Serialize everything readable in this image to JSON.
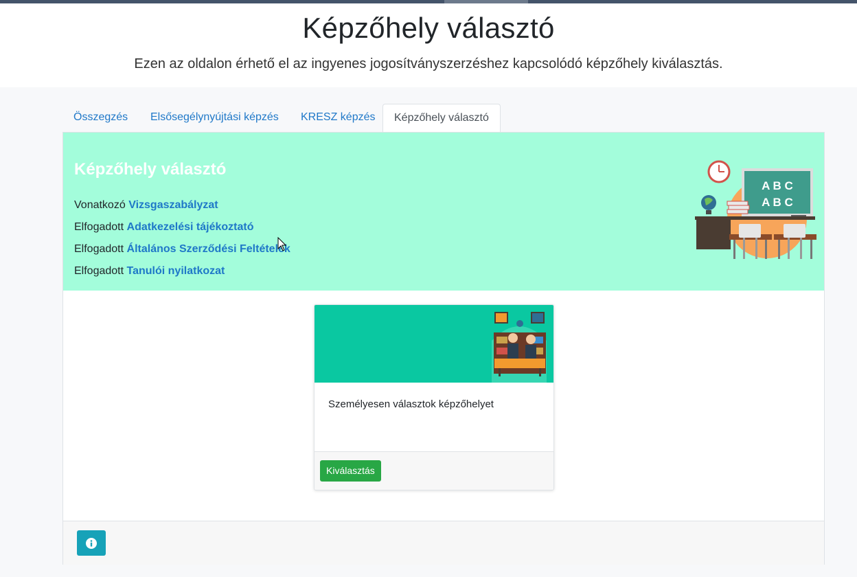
{
  "header": {
    "title": "Képzőhely választó",
    "subtitle": "Ezen az oldalon érhető el az ingyenes jogosítványszerzéshez kapcsolódó képzőhely kiválasztás."
  },
  "tabs": [
    {
      "label": "Összegzés",
      "active": false
    },
    {
      "label": "Elsősegélynyújtási képzés",
      "active": false
    },
    {
      "label": "KRESZ képzés",
      "active": false
    },
    {
      "label": "Képzőhely választó",
      "active": true
    }
  ],
  "hero": {
    "title": "Képzőhely választó",
    "lines": [
      {
        "prefix": "Vonatkozó",
        "link": "Vizsgaszabályzat"
      },
      {
        "prefix": "Elfogadott",
        "link": "Adatkezelési tájékoztató"
      },
      {
        "prefix": "Elfogadott",
        "link": "Általános Szerződési Feltételek"
      },
      {
        "prefix": "Elfogadott",
        "link": "Tanulói nyilatkozat"
      }
    ],
    "board_text": [
      "A B C",
      "A B C"
    ]
  },
  "card": {
    "text": "Személyesen választok képzőhelyet",
    "button": "Kiválasztás"
  },
  "footer": {
    "info_icon": "info-icon"
  },
  "colors": {
    "hero_bg": "#a3fddb",
    "card_img_bg": "#0ac8a1",
    "link": "#1f78c8",
    "btn_green": "#28a745",
    "btn_info": "#17a2b8"
  }
}
